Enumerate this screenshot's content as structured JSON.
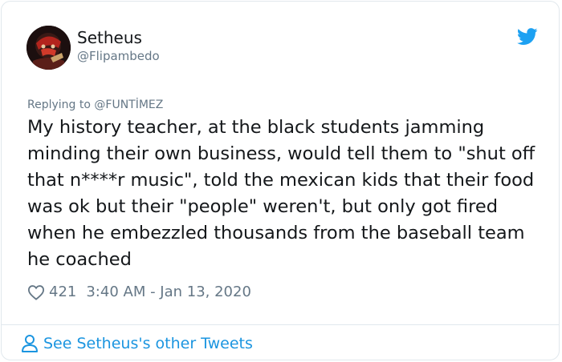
{
  "author": {
    "display_name": "Setheus",
    "handle": "@Flipambedo"
  },
  "reply": {
    "prefix": "Replying to",
    "mention": "@FUNTİMEZ"
  },
  "tweet": {
    "text": "My history teacher, at the black students jamming minding their own business, would tell them to \"shut off that n****r music\", told the mexican kids that their food was ok but their \"people\" weren't, but only got fired when he embezzled thousands from the baseball team he coached",
    "likes": "421",
    "timestamp": "3:40 AM - Jan 13, 2020"
  },
  "footer": {
    "link_label": "See Setheus's other Tweets"
  },
  "icons": {
    "brand": "twitter-bird-icon",
    "like": "heart-icon",
    "profile": "person-icon"
  },
  "colors": {
    "brand_blue": "#1da1f2",
    "link_blue": "#1b95e0",
    "secondary_text": "#657786",
    "primary_text": "#14171a",
    "border": "#e1e8ed"
  }
}
